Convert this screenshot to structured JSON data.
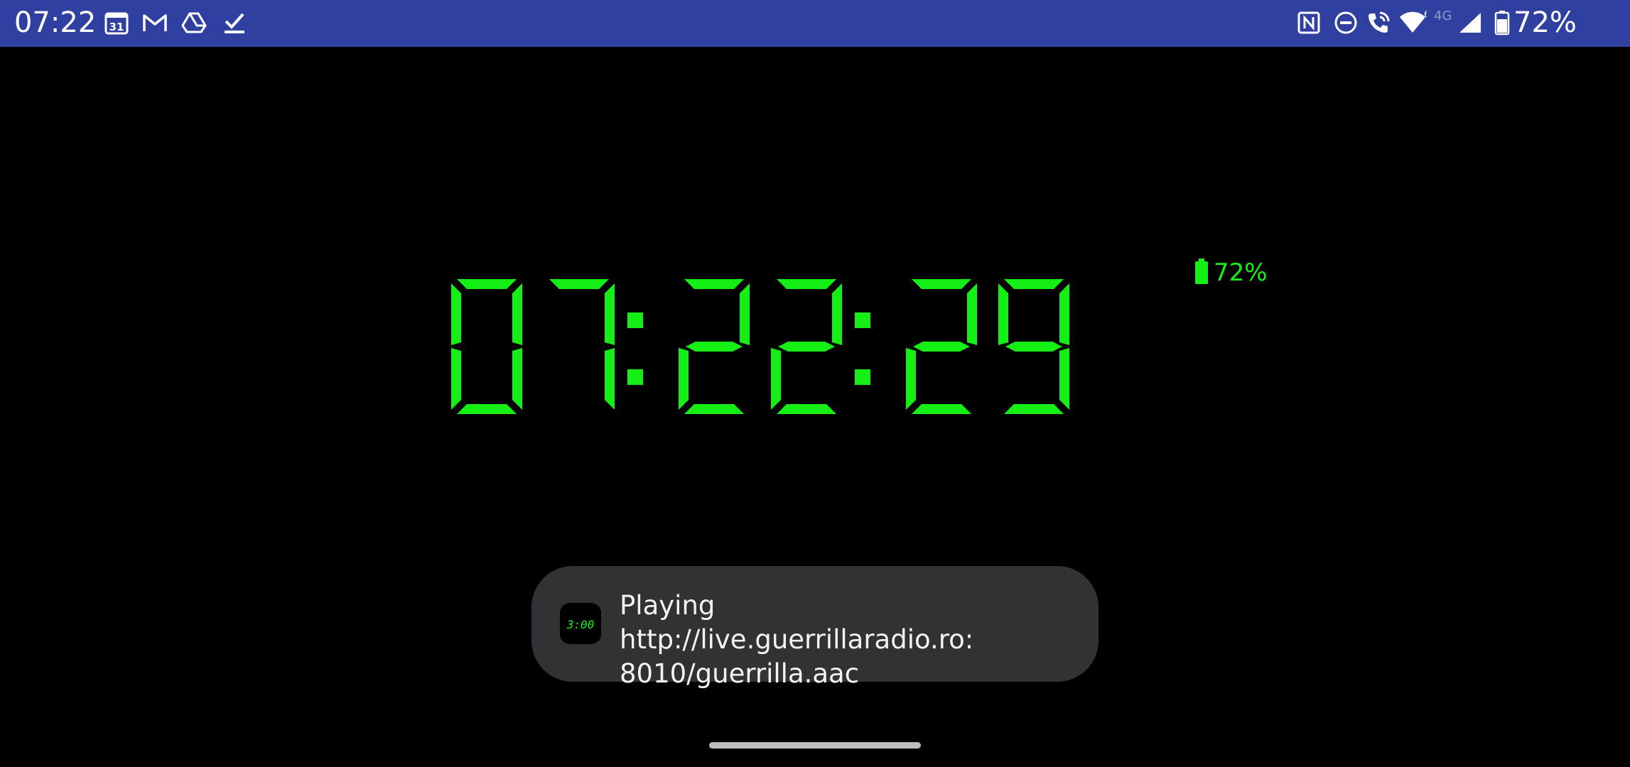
{
  "status_bar": {
    "time": "07:22",
    "network_type": "4G",
    "battery_percent": "72%",
    "background_color": "#3040a0",
    "left_icons": [
      "calendar-icon",
      "gmail-icon",
      "drive-icon",
      "tasks-icon"
    ],
    "right_icons": [
      "nfc-icon",
      "do-not-disturb-icon",
      "wifi-calling-icon",
      "wifi-icon",
      "signal-icon",
      "battery-icon"
    ],
    "calendar_icon_label": "31"
  },
  "clock": {
    "hours": "07",
    "minutes": "22",
    "seconds": "29",
    "separator": ":",
    "color": "#15ef15"
  },
  "battery_indicator": {
    "text": "72%"
  },
  "toast": {
    "message": "Playing http://live.guerrillaradio.ro:\n8010/guerrilla.aac",
    "icon_text": "3:00"
  }
}
